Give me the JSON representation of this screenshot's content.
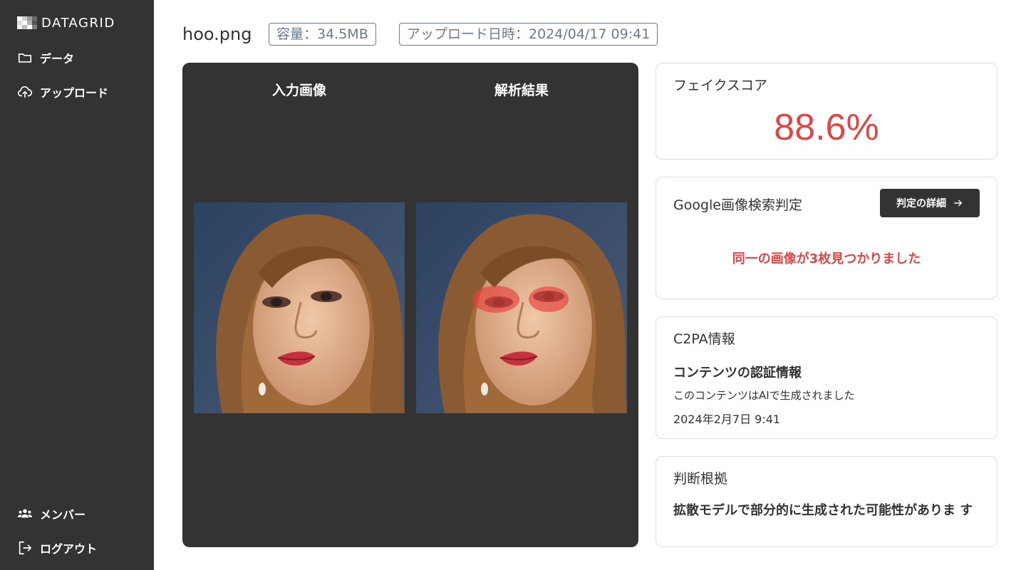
{
  "app": {
    "logo_text": "DATAGRID",
    "logo_colors": [
      "#ffffff",
      "#bdbdbd",
      "#8a8a8a",
      "#5a5a5a"
    ]
  },
  "sidebar": {
    "items": [
      {
        "label": "データ",
        "icon": "folder-icon"
      },
      {
        "label": "アップロード",
        "icon": "cloud-upload-icon"
      }
    ],
    "bottom_items": [
      {
        "label": "メンバー",
        "icon": "members-icon"
      },
      {
        "label": "ログアウト",
        "icon": "logout-icon"
      }
    ]
  },
  "header": {
    "file_name": "hoo.png",
    "size_badge": "容量：34.5MB",
    "upload_badge": "アップロード日時：2024/04/17 09:41"
  },
  "image_panel": {
    "input_title": "入力画像",
    "result_title": "解析結果"
  },
  "fake_score": {
    "title": "フェイクスコア",
    "value": "88.6%",
    "color": "#e04646"
  },
  "google_search": {
    "title": "Google画像検索判定",
    "button_label": "判定の詳細",
    "result": "同一の画像が3枚見つかりました"
  },
  "c2pa": {
    "title": "C2PA情報",
    "subtitle": "コンテンツの認証情報",
    "description": "このコンテンツはAIで生成されました",
    "date": "2024年2月7日 9:41"
  },
  "reason": {
    "title": "判断根拠",
    "text": "拡散モデルで部分的に生成された可能性がありま す"
  }
}
